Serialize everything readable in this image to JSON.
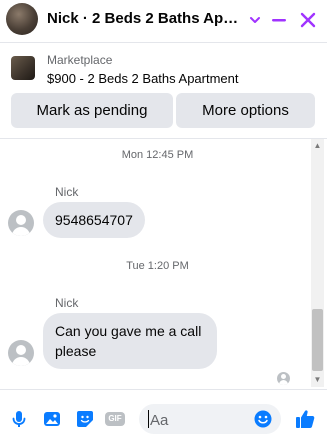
{
  "header": {
    "title": "Nick · 2 Beds 2 Baths Apar…",
    "accent_color": "#a033ff",
    "icons": [
      "chevron-down-icon",
      "minimize-icon",
      "close-icon"
    ]
  },
  "listing": {
    "source": "Marketplace",
    "title": "$900 - 2 Beds 2 Baths Apartment",
    "mark_pending_label": "Mark as pending",
    "more_options_label": "More options"
  },
  "messages": {
    "groups": [
      {
        "timestamp": "Mon 12:45 PM",
        "sender": "Nick",
        "text": "9548654707"
      },
      {
        "timestamp": "Tue 1:20 PM",
        "sender": "Nick",
        "text": "Can you gave me a call please"
      }
    ]
  },
  "composer": {
    "placeholder": "Aa",
    "gif_label": "GIF",
    "accent_color": "#0a7cff",
    "icons": [
      "microphone-icon",
      "photo-icon",
      "sticker-icon",
      "gif-icon",
      "emoji-icon",
      "thumbs-up-icon"
    ]
  }
}
